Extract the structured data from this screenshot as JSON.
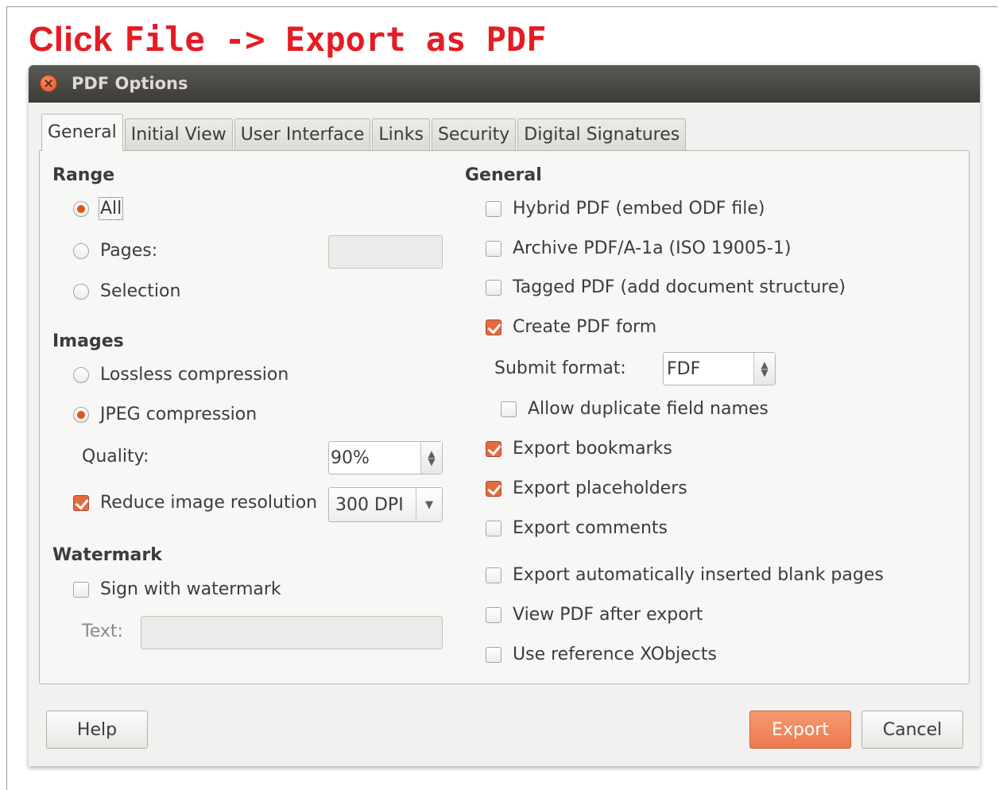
{
  "instruction": {
    "word": "Click",
    "command": "File -> Export as PDF",
    "color": "#e51c23"
  },
  "window": {
    "title": "PDF Options"
  },
  "tabs": [
    {
      "label": "General",
      "active": true
    },
    {
      "label": "Initial View",
      "active": false
    },
    {
      "label": "User Interface",
      "active": false
    },
    {
      "label": "Links",
      "active": false
    },
    {
      "label": "Security",
      "active": false
    },
    {
      "label": "Digital Signatures",
      "active": false
    }
  ],
  "range": {
    "heading": "Range",
    "all_label": "All",
    "pages_label": "Pages:",
    "pages_value": "",
    "selection_label": "Selection",
    "selected": "All"
  },
  "images": {
    "heading": "Images",
    "lossless_label": "Lossless compression",
    "jpeg_label": "JPEG compression",
    "selected": "JPEG compression",
    "quality_label": "Quality:",
    "quality_value": "90%",
    "reduce_label": "Reduce image resolution",
    "reduce_checked": true,
    "resolution_value": "300 DPI"
  },
  "watermark": {
    "heading": "Watermark",
    "sign_label": "Sign with watermark",
    "sign_checked": false,
    "text_label": "Text:",
    "text_value": ""
  },
  "general": {
    "heading": "General",
    "hybrid_label": "Hybrid PDF (embed ODF file)",
    "archive_label": "Archive PDF/A-1a (ISO 19005-1)",
    "tagged_label": "Tagged PDF (add document structure)",
    "create_form_label": "Create PDF form",
    "submit_format_label": "Submit format:",
    "submit_format_value": "FDF",
    "allow_duplicate_label": "Allow duplicate field names",
    "export_bookmarks_label": "Export bookmarks",
    "export_placeholders_label": "Export placeholders",
    "export_comments_label": "Export comments",
    "export_blank_label": "Export automatically inserted blank pages",
    "view_after_label": "View PDF after export",
    "use_xobjects_label": "Use reference XObjects",
    "checked": {
      "hybrid": false,
      "archive": false,
      "tagged": false,
      "create_form": true,
      "allow_duplicate": false,
      "export_bookmarks": true,
      "export_placeholders": true,
      "export_comments": false,
      "export_blank": false,
      "view_after": false,
      "use_xobjects": false
    }
  },
  "buttons": {
    "help": "Help",
    "export": "Export",
    "cancel": "Cancel"
  },
  "colors": {
    "accent": "#e36b3e",
    "titlebar": "#3d3c38",
    "close": "#e2512a"
  }
}
